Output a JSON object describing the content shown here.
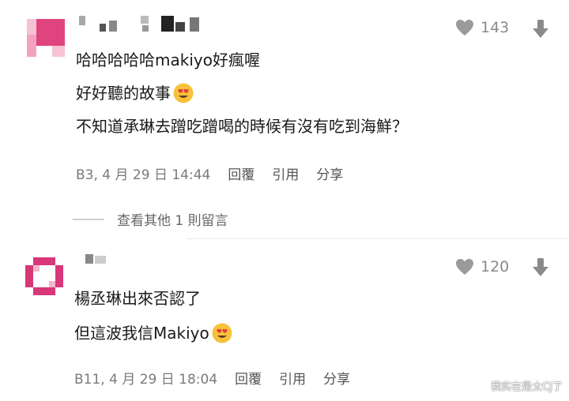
{
  "comments": [
    {
      "likes": "143",
      "lines": [
        "哈哈哈哈哈makiyo好瘋喔",
        "好好聽的故事",
        "不知道承琳去蹭吃蹭喝的時候有沒有吃到海鮮？"
      ],
      "meta": "B3, 4 月 29 日 14:44",
      "actions": [
        "回覆",
        "引用",
        "分享"
      ],
      "more_replies": "查看其他 1 則留言"
    },
    {
      "likes": "120",
      "lines": [
        "楊丞琳出來否認了",
        "但這波我信Makiyo"
      ],
      "meta": "B11, 4 月 29 日 18:04",
      "actions": [
        "回覆",
        "引用",
        "分享"
      ]
    }
  ],
  "watermark": "我实在是太CJ了",
  "colors": {
    "avatar_pink": "#e0447f",
    "avatar_light": "#f7c2d4",
    "text_gray": "#7a7a7a"
  },
  "icons": [
    "heart-icon",
    "downvote-arrow-icon",
    "heart-eyes-emoji"
  ]
}
